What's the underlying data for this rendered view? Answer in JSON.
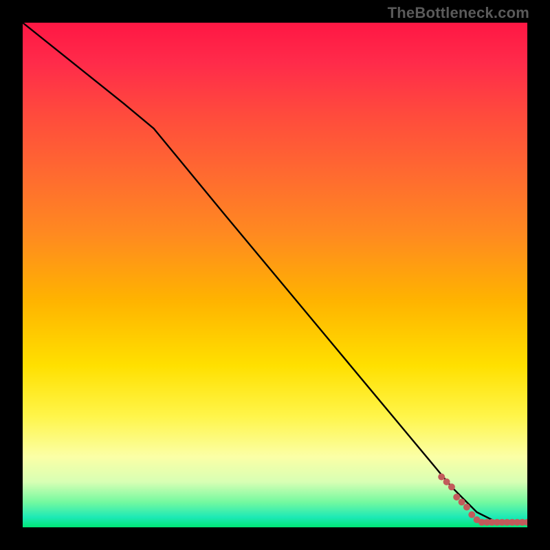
{
  "watermark": "TheBottleneck.com",
  "colors": {
    "line": "#000000",
    "dot": "#c25b5b",
    "gradient_top": "#ff1744",
    "gradient_bottom": "#00e676"
  },
  "chart_data": {
    "type": "line",
    "title": "",
    "xlabel": "",
    "ylabel": "",
    "xlim": [
      0,
      100
    ],
    "ylim": [
      0,
      100
    ],
    "series": [
      {
        "name": "black-line",
        "x": [
          0,
          10,
          20,
          26,
          40,
          55,
          70,
          80,
          85,
          90,
          94,
          100
        ],
        "y": [
          100,
          92,
          84,
          79,
          62,
          44,
          26,
          14,
          8,
          3,
          1,
          1
        ]
      }
    ],
    "dots": [
      {
        "x": 83,
        "y": 10.0
      },
      {
        "x": 84,
        "y": 9.0
      },
      {
        "x": 85,
        "y": 8.0
      },
      {
        "x": 86,
        "y": 6.0
      },
      {
        "x": 87,
        "y": 5.0
      },
      {
        "x": 88,
        "y": 4.0
      },
      {
        "x": 89,
        "y": 2.5
      },
      {
        "x": 90,
        "y": 1.5
      },
      {
        "x": 91,
        "y": 1.0
      },
      {
        "x": 92,
        "y": 1.0
      },
      {
        "x": 93,
        "y": 1.0
      },
      {
        "x": 94,
        "y": 1.0
      },
      {
        "x": 95,
        "y": 1.0
      },
      {
        "x": 96,
        "y": 1.0
      },
      {
        "x": 97,
        "y": 1.0
      },
      {
        "x": 98,
        "y": 1.0
      },
      {
        "x": 99,
        "y": 1.0
      },
      {
        "x": 100,
        "y": 1.0
      }
    ]
  }
}
